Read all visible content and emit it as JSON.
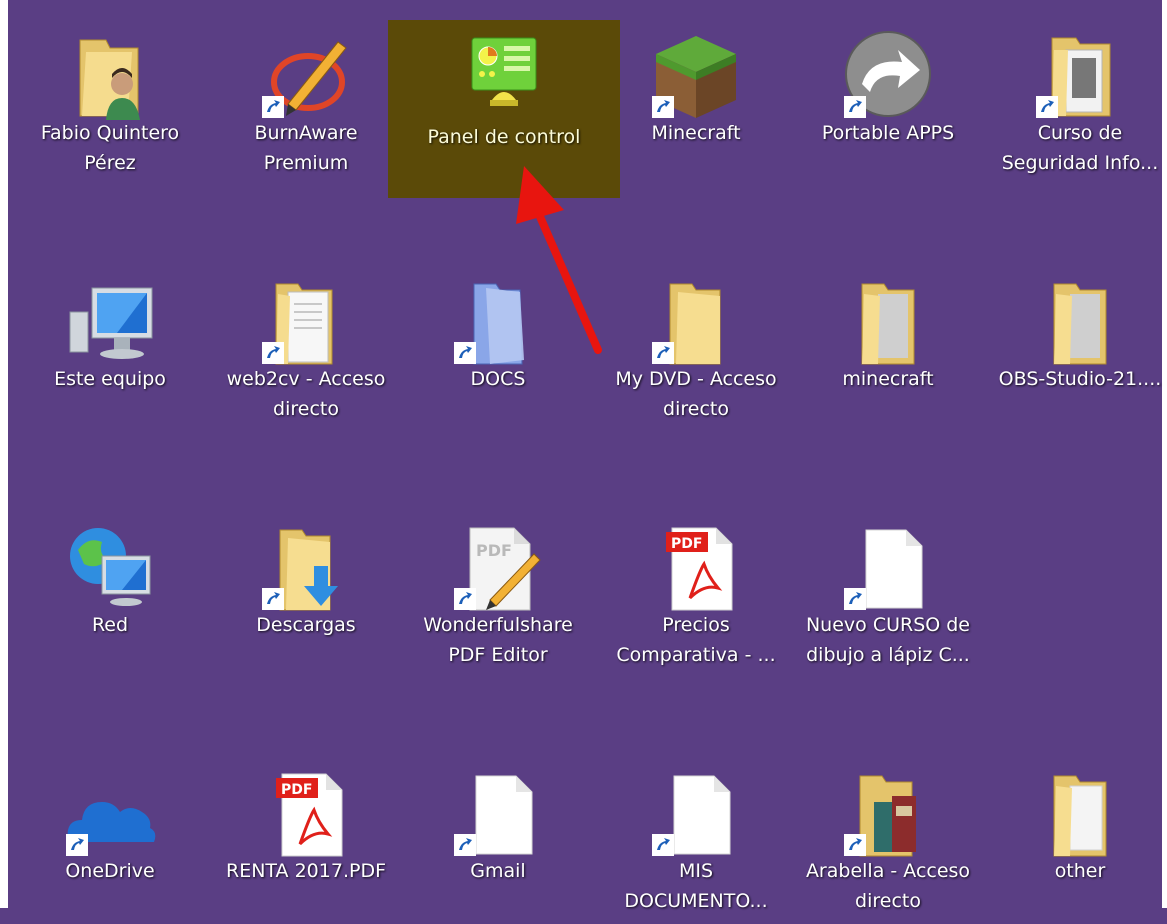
{
  "desktop": {
    "background_color": "#5a3e84",
    "selection_color": "#5b4a08",
    "annotation_arrow_color": "#e8150f",
    "icons": [
      {
        "label": "Fabio Quintero\nPérez",
        "icon": "user-folder-icon"
      },
      {
        "label": "BurnAware\nPremium",
        "icon": "burnaware-icon",
        "shortcut": true
      },
      {
        "label": "Panel de control",
        "icon": "control-panel-icon",
        "selected": true
      },
      {
        "label": "Minecraft",
        "icon": "minecraft-icon",
        "shortcut": true
      },
      {
        "label": "Portable APPS",
        "icon": "portable-apps-icon",
        "shortcut": true
      },
      {
        "label": "Curso de\nSeguridad Info...",
        "icon": "document-folder-icon",
        "shortcut": true
      },
      {
        "label": "Este equipo",
        "icon": "this-pc-icon"
      },
      {
        "label": "web2cv - Acceso\ndirecto",
        "icon": "document-folder-icon",
        "shortcut": true
      },
      {
        "label": "DOCS",
        "icon": "docs-folder-icon",
        "shortcut": true
      },
      {
        "label": "My DVD - Acceso\ndirecto",
        "icon": "folder-icon",
        "shortcut": true
      },
      {
        "label": "minecraft",
        "icon": "folder-icon"
      },
      {
        "label": "OBS-Studio-21....",
        "icon": "folder-icon"
      },
      {
        "label": "Red",
        "icon": "network-icon"
      },
      {
        "label": "Descargas",
        "icon": "downloads-folder-icon",
        "shortcut": true
      },
      {
        "label": "Wonderfulshare\nPDF Editor",
        "icon": "pdf-editor-icon",
        "shortcut": true
      },
      {
        "label": "Precios\nComparativa - ...",
        "icon": "pdf-file-icon"
      },
      {
        "label": "Nuevo CURSO de\ndibujo a lápiz C...",
        "icon": "blank-file-icon",
        "shortcut": true
      },
      {
        "label": "OneDrive",
        "icon": "onedrive-icon",
        "shortcut": true
      },
      {
        "label": "RENTA 2017.PDF",
        "icon": "pdf-file-icon"
      },
      {
        "label": "Gmail",
        "icon": "blank-file-icon",
        "shortcut": true
      },
      {
        "label": "MIS\nDOCUMENTO...",
        "icon": "blank-file-icon",
        "shortcut": true
      },
      {
        "label": "Arabella - Acceso\ndirecto",
        "icon": "book-folder-icon",
        "shortcut": true
      },
      {
        "label": "other",
        "icon": "folder-icon"
      }
    ]
  }
}
